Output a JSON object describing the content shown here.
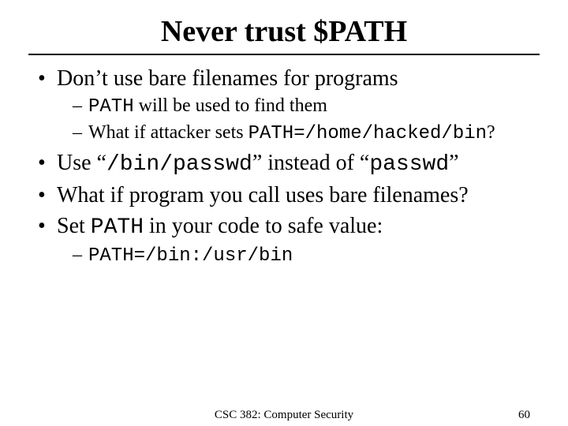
{
  "title": "Never trust $PATH",
  "b1": "Don’t use bare filenames for programs",
  "b1_s1_mono": "PATH",
  "b1_s1_rest": " will be used to find them",
  "b1_s2_lead": "What if attacker sets ",
  "b1_s2_mono": "PATH=/home/hacked/bin",
  "b1_s2_tail": "?",
  "b2_lead": "Use ",
  "b2_q1": "“",
  "b2_mono1": "/bin/passwd",
  "b2_q2": "”",
  "b2_mid": " instead of “",
  "b2_mono2": "passwd",
  "b2_tail": "”",
  "b3": "What if program you call uses bare filenames?",
  "b4_lead": "Set ",
  "b4_mono": "PATH",
  "b4_tail": " in your code to safe value:",
  "b4_s1_mono": "PATH=/bin:/usr/bin",
  "footer_course": "CSC 382: Computer Security",
  "footer_num": "60"
}
